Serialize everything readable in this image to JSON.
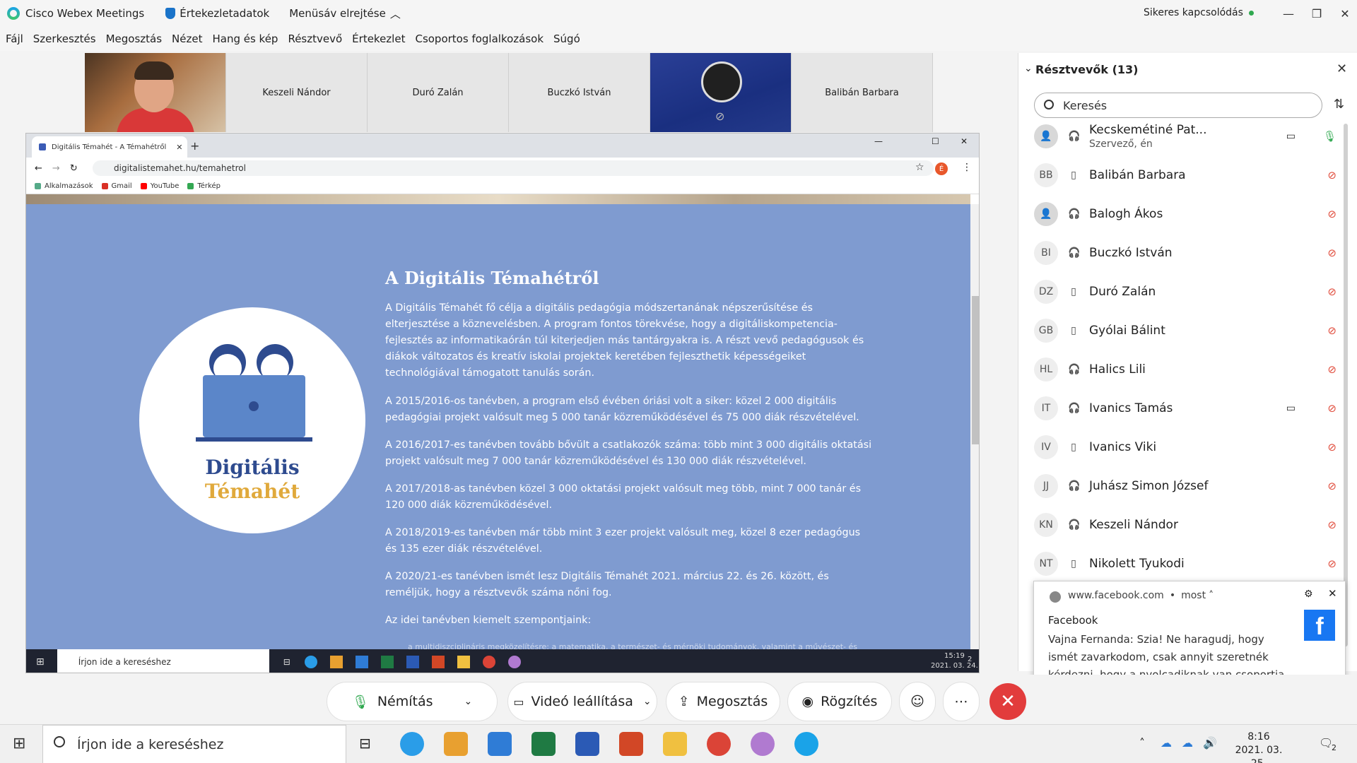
{
  "titlebar": {
    "app_name": "Cisco Webex Meetings",
    "meeting_info": "Értekezletadatok",
    "hide_menu": "Menüsáv elrejtése",
    "connection_status": "Sikeres kapcsolódás",
    "status_color": "#2fa84f"
  },
  "menubar": [
    "Fájl",
    "Szerkesztés",
    "Megosztás",
    "Nézet",
    "Hang és kép",
    "Résztvevő",
    "Értekezlet",
    "Csoportos foglalkozások",
    "Súgó"
  ],
  "video_strip": {
    "tiles": [
      "Keszeli Nándor",
      "Duró Zalán",
      "Buczkó István",
      "Balibán Barbara"
    ]
  },
  "browser": {
    "tab_title": "Digitális Témahét - A Témahétről",
    "url": "digitalistemahet.hu/temahetrol",
    "profile_letter": "É",
    "bookmarks": [
      "Alkalmazások",
      "Gmail",
      "YouTube",
      "Térkép"
    ],
    "page": {
      "logo_line1": "Digitális",
      "logo_line2": "Témahét",
      "heading": "A Digitális Témahétről",
      "paragraphs": [
        "A Digitális Témahét fő célja a digitális pedagógia módszertanának népszerűsítése és elterjesztése a köznevelésben.  A program fontos törekvése, hogy a digitáliskompetencia-fejlesztés az informatikaórán túl kiterjedjen más tantárgyakra is. A részt vevő pedagógusok és diákok változatos és kreatív iskolai projektek keretében fejleszthetik képességeiket technológiával támogatott tanulás során.",
        "A 2015/2016-os tanévben, a program első évében óriási volt a siker: közel 2 000 digitális pedagógiai projekt valósult meg 5 000 tanár közreműködésével és 75 000 diák részvételével.",
        "A 2016/2017-es tanévben tovább bővült a csatlakozók száma: több mint 3 000 digitális oktatási projekt valósult meg 7 000 tanár közreműködésével és 130 000 diák részvételével.",
        "A 2017/2018-as tanévben közel 3 000 oktatási projekt valósult meg több, mint 7 000 tanár és 120 000 diák közreműködésével.",
        "A 2018/2019-es tanévben már több mint 3 ezer projekt valósult meg, közel 8 ezer pedagógus és 135 ezer diák részvételével.",
        "A 2020/21-es tanévben ismét lesz Digitális Témahét 2021. március 22. és 26. között, és reméljük, hogy a résztvevők száma nőni fog.",
        "Az idei tanévben kiemelt szempontjaink:"
      ],
      "bullet_partial": "a multidiszciplináris megközelítésre: a matematika, a természet- és mérnöki tudományok, valamint a művészet- és"
    },
    "inner_taskbar": {
      "search_placeholder": "Írjon ide a kereséshez",
      "time": "15:19",
      "date": "2021. 03. 24.",
      "notif_count": "2"
    }
  },
  "participants": {
    "title": "Résztvevők (13)",
    "search_placeholder": "Keresés",
    "list": [
      {
        "initials": "",
        "name": "Kecskeméti​né Pat...",
        "sub": "Szervező, én",
        "device": "headset",
        "video": true,
        "mic": "on"
      },
      {
        "initials": "BB",
        "name": "Balibán Barbara",
        "device": "phone",
        "mic": "off"
      },
      {
        "initials": "",
        "name": "Balogh Ákos",
        "device": "headset",
        "mic": "off"
      },
      {
        "initials": "BI",
        "name": "Buczkó István",
        "device": "headset",
        "mic": "off"
      },
      {
        "initials": "DZ",
        "name": "Duró Zalán",
        "device": "phone",
        "mic": "off"
      },
      {
        "initials": "GB",
        "name": "Gyólai Bálint",
        "device": "phone",
        "mic": "off"
      },
      {
        "initials": "HL",
        "name": "Halics Lili",
        "device": "headset",
        "mic": "off"
      },
      {
        "initials": "IT",
        "name": "Ivanics Tamás",
        "device": "headset",
        "video": true,
        "mic": "off"
      },
      {
        "initials": "IV",
        "name": "Ivanics Viki",
        "device": "phone",
        "mic": "off"
      },
      {
        "initials": "JJ",
        "name": "Juhász Simon József",
        "device": "headset",
        "mic": "off"
      },
      {
        "initials": "KN",
        "name": "Keszeli Nándor",
        "device": "headset",
        "mic": "off"
      },
      {
        "initials": "NT",
        "name": "Nikolett Tyukodi",
        "device": "phone",
        "mic": "off"
      }
    ]
  },
  "notification": {
    "source": "www.facebook.com",
    "time": "most",
    "app": "Facebook",
    "message": "Vajna Fernanda: Szia! Ne haragudj, hogy ismét zavarkodom, csak annyit szeretnék kérdezni, hogy a nyolcadiknak van csoportja, mert nem találom?! 😅"
  },
  "controls": {
    "mute": "Némítás",
    "video": "Videó leállítása",
    "share": "Megosztás",
    "record": "Rögzítés"
  },
  "taskbar": {
    "search_placeholder": "Írjon ide a kereséshez",
    "time": "8:16",
    "date": "2021. 03. 25.",
    "notif_count": "2"
  },
  "colors": {
    "page_bg": "#7f9bd0",
    "end_button": "#e23c3c",
    "mic_off": "#e04a3a",
    "mic_on": "#2fa84f",
    "facebook": "#1877f2"
  }
}
